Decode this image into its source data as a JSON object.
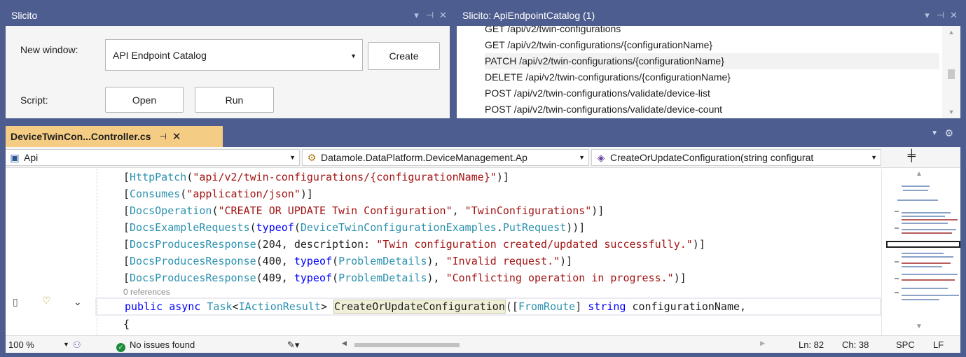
{
  "slicito_panel": {
    "title": "Slicito",
    "new_window_label": "New window:",
    "selected_window": "API Endpoint Catalog",
    "create_label": "Create",
    "script_label": "Script:",
    "open_label": "Open",
    "run_label": "Run"
  },
  "results_panel": {
    "title": "Slicito: ApiEndpointCatalog (1)",
    "items": [
      "GET /api/v2/twin-configurations",
      "GET /api/v2/twin-configurations/{configurationName}",
      "PATCH /api/v2/twin-configurations/{configurationName}",
      "DELETE /api/v2/twin-configurations/{configurationName}",
      "POST /api/v2/twin-configurations/validate/device-list",
      "POST /api/v2/twin-configurations/validate/device-count"
    ],
    "selected_index": 2
  },
  "editor": {
    "tab_title": "DeviceTwinCon...Controller.cs",
    "nav_project": "Api",
    "nav_class": "Datamole.DataPlatform.DeviceManagement.Ap",
    "nav_member": "CreateOrUpdateConfiguration(string configurat",
    "code": {
      "l1": {
        "a": "[",
        "b": "HttpPatch",
        "c": "(",
        "d": "\"api/v2/twin-configurations/{configurationName}\"",
        "e": ")]"
      },
      "l2": {
        "a": "[",
        "b": "Consumes",
        "c": "(",
        "d": "\"application/json\"",
        "e": ")]"
      },
      "l3": {
        "a": "[",
        "b": "DocsOperation",
        "c": "(",
        "d": "\"CREATE OR UPDATE Twin Configuration\"",
        "e": ", ",
        "f": "\"TwinConfigurations\"",
        "g": ")]"
      },
      "l4": {
        "a": "[",
        "b": "DocsExampleRequests",
        "c": "(",
        "d": "typeof",
        "e": "(",
        "f": "DeviceTwinConfigurationExamples",
        "g": ".",
        "h": "PutRequest",
        "i": "))]"
      },
      "l5": {
        "a": "[",
        "b": "DocsProducesResponse",
        "c": "(204, description: ",
        "d": "\"Twin configuration created/updated successfully.\"",
        "e": ")]"
      },
      "l6": {
        "a": "[",
        "b": "DocsProducesResponse",
        "c": "(400, ",
        "d": "typeof",
        "e": "(",
        "f": "ProblemDetails",
        "g": "), ",
        "h": "\"Invalid request.\"",
        "i": ")]"
      },
      "l7": {
        "a": "[",
        "b": "DocsProducesResponse",
        "c": "(409, ",
        "d": "typeof",
        "e": "(",
        "f": "ProblemDetails",
        "g": "), ",
        "h": "\"Conflicting operation in progress.\"",
        "i": ")]"
      },
      "refs": "0 references",
      "l8": {
        "a": "public",
        "b": " ",
        "c": "async",
        "d": " ",
        "e": "Task",
        "f": "<",
        "g": "IActionResult",
        "h": "> ",
        "i": "CreateOrUpdateConfiguration",
        "j": "([",
        "k": "FromRoute",
        "l": "] ",
        "m": "string",
        "n": " configurationName,"
      },
      "l9": "{"
    }
  },
  "status_bar": {
    "zoom": "100 %",
    "issues": "No issues found",
    "line": "Ln: 82",
    "col": "Ch: 38",
    "whitespace": "SPC",
    "line_ending": "LF"
  }
}
